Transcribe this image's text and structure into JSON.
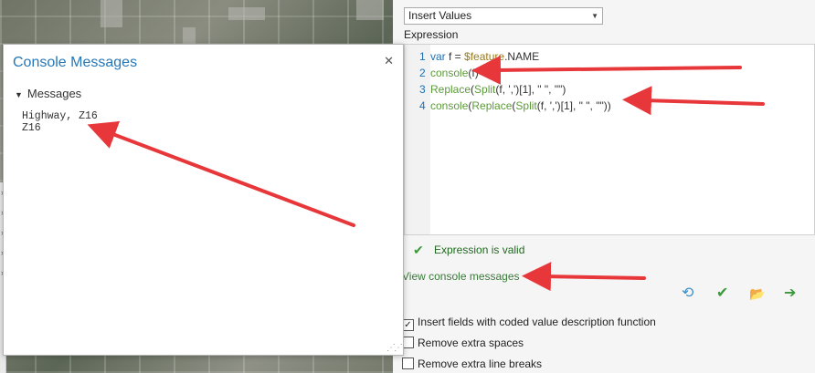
{
  "panel": {
    "insert_dropdown": "Insert Values",
    "expression_label": "Expression",
    "code_lines": [
      {
        "num": "1",
        "parts": [
          {
            "t": "var ",
            "c": "kw"
          },
          {
            "t": "f = ",
            "c": "tx"
          },
          {
            "t": "$feature",
            "c": "fe"
          },
          {
            "t": ".NAME",
            "c": "tx"
          }
        ]
      },
      {
        "num": "2",
        "parts": [
          {
            "t": "console",
            "c": "fn"
          },
          {
            "t": "(f)",
            "c": "tx"
          }
        ]
      },
      {
        "num": "3",
        "parts": [
          {
            "t": "Replace",
            "c": "fn"
          },
          {
            "t": "(",
            "c": "tx"
          },
          {
            "t": "Split",
            "c": "fn"
          },
          {
            "t": "(f, ',')[1], \" \", \"\")",
            "c": "tx"
          }
        ]
      },
      {
        "num": "4",
        "parts": [
          {
            "t": "console",
            "c": "fn"
          },
          {
            "t": "(",
            "c": "tx"
          },
          {
            "t": "Replace",
            "c": "fn"
          },
          {
            "t": "(",
            "c": "tx"
          },
          {
            "t": "Split",
            "c": "fn"
          },
          {
            "t": "(f, ',')[1], \" \", \"\"))",
            "c": "tx"
          }
        ]
      }
    ],
    "valid_text": "Expression is valid",
    "view_console": "View console messages",
    "options": [
      {
        "label": "Insert fields with coded value description function",
        "checked": true
      },
      {
        "label": "Remove extra spaces",
        "checked": false
      },
      {
        "label": "Remove extra line breaks",
        "checked": false
      }
    ]
  },
  "dialog": {
    "title": "Console Messages",
    "messages_header": "Messages",
    "output_lines": [
      "Highway, Z16",
      "Z16"
    ]
  },
  "icons": {
    "close": "close-icon",
    "check": "checkmark-icon",
    "undo": "undo-icon",
    "folder": "folder-icon",
    "arrow": "arrow-right-icon"
  },
  "colors": {
    "accent_blue": "#2677b8",
    "valid_green": "#3a9a3a",
    "annotation_red": "#e8373a"
  }
}
